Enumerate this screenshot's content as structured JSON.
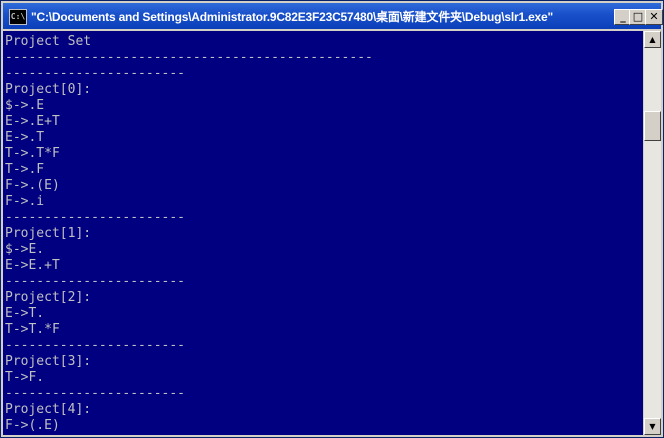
{
  "window": {
    "title": "\"C:\\Documents and Settings\\Administrator.9C82E3F23C57480\\桌面\\新建文件夹\\Debug\\slr1.exe\"",
    "app_icon": "console-app-icon",
    "app_icon_text": "C:\\",
    "minimize_glyph": "_",
    "maximize_glyph": "□",
    "close_glyph": "✕"
  },
  "console": {
    "background": "#000080",
    "foreground": "#c0c0c0",
    "lines": [
      "Project Set",
      "-----------------------------------------------",
      "-----------------------",
      "Project[0]:",
      "$->.E",
      "E->.E+T",
      "E->.T",
      "T->.T*F",
      "T->.F",
      "F->.(E)",
      "F->.i",
      "-----------------------",
      "Project[1]:",
      "$->E.",
      "E->E.+T",
      "-----------------------",
      "Project[2]:",
      "E->T.",
      "T->T.*F",
      "-----------------------",
      "Project[3]:",
      "T->F.",
      "-----------------------",
      "Project[4]:",
      "F->(.E)"
    ]
  },
  "scrollbar": {
    "up_glyph": "▲",
    "down_glyph": "▼"
  }
}
